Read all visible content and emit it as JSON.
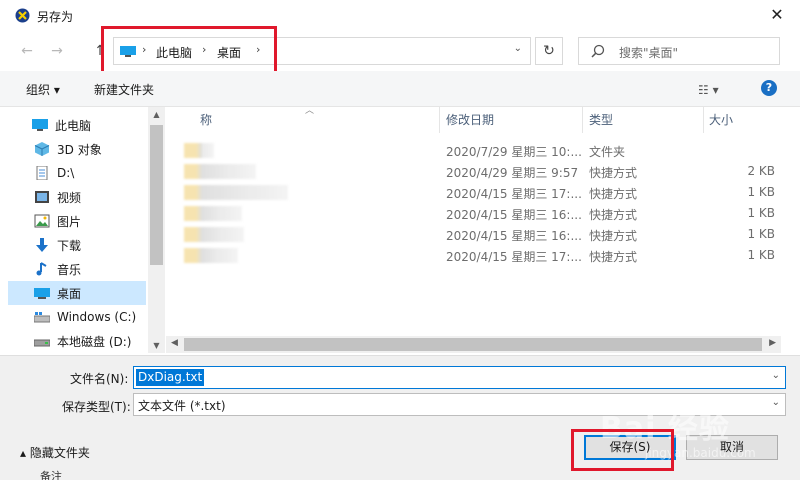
{
  "window": {
    "title": "另存为",
    "close_glyph": "✕"
  },
  "nav": {
    "back_glyph": "←",
    "forward_glyph": "→",
    "up_glyph": "↑",
    "path": [
      {
        "label": "此电脑"
      },
      {
        "label": "桌面"
      }
    ],
    "sep_glyph": "›",
    "dropdown_glyph": "⌄",
    "refresh_glyph": "↻",
    "search_placeholder": "搜索\"桌面\""
  },
  "toolbar": {
    "organize": "组织 ▾",
    "new_folder": "新建文件夹",
    "view_glyph": "☷ ▾",
    "help": "?"
  },
  "sidebar": {
    "items": [
      {
        "label": "此电脑",
        "icon": "pc-icon"
      },
      {
        "label": "3D 对象",
        "icon": "cube-icon"
      },
      {
        "label": "D:\\",
        "icon": "document-icon"
      },
      {
        "label": "视频",
        "icon": "video-icon"
      },
      {
        "label": "图片",
        "icon": "picture-icon"
      },
      {
        "label": "下载",
        "icon": "download-icon"
      },
      {
        "label": "音乐",
        "icon": "music-icon"
      },
      {
        "label": "桌面",
        "icon": "desktop-icon",
        "selected": true
      },
      {
        "label": "Windows (C:)",
        "icon": "drive-icon"
      },
      {
        "label": "本地磁盘 (D:)",
        "icon": "drive-icon"
      }
    ]
  },
  "filelist": {
    "columns": {
      "name": "名称",
      "modified": "修改日期",
      "type": "类型",
      "size": "大小"
    },
    "name_visible": "称",
    "rows": [
      {
        "modified": "2020/7/29 星期三 10:...",
        "type": "文件夹",
        "size": ""
      },
      {
        "modified": "2020/4/29 星期三 9:57",
        "type": "快捷方式",
        "size": "2 KB"
      },
      {
        "modified": "2020/4/15 星期三 17:...",
        "type": "快捷方式",
        "size": "1 KB"
      },
      {
        "modified": "2020/4/15 星期三 16:...",
        "type": "快捷方式",
        "size": "1 KB"
      },
      {
        "modified": "2020/4/15 星期三 16:...",
        "type": "快捷方式",
        "size": "1 KB"
      },
      {
        "modified": "2020/4/15 星期三 17:...",
        "type": "快捷方式",
        "size": "1 KB"
      }
    ]
  },
  "form": {
    "filename_label": "文件名(N):",
    "filename_value": "DxDiag.txt",
    "filetype_label": "保存类型(T):",
    "filetype_value": "文本文件 (*.txt)",
    "hide_folders": "隐藏文件夹",
    "save": "保存(S)",
    "cancel": "取消",
    "footer": "备注"
  },
  "watermark": {
    "main": "Bai 经验",
    "sub": "jingyan.baidu.com"
  },
  "colors": {
    "accent": "#0078d7",
    "highlight_box": "#e0182c",
    "selected_bg": "#cce8ff"
  }
}
